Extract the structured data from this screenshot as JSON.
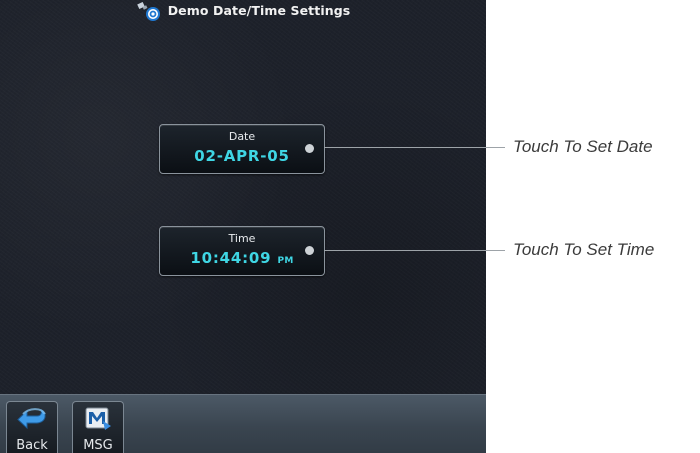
{
  "header": {
    "title": "Demo Date/Time Settings",
    "icon": "satellite-settings-icon"
  },
  "fields": {
    "date": {
      "label": "Date",
      "value": "02-APR-05"
    },
    "time": {
      "label": "Time",
      "value": "10:44:09",
      "suffix": "PM"
    }
  },
  "softkeys": {
    "back": {
      "label": "Back",
      "icon": "back-arrow-icon"
    },
    "msg": {
      "label": "MSG",
      "icon": "message-icon"
    }
  },
  "callouts": {
    "date": "Touch To Set Date",
    "time": "Touch To Set Time"
  },
  "colors": {
    "value_text": "#3fd6e4",
    "screen_background": "#1d212a",
    "bottom_bar": "#3a4550"
  }
}
